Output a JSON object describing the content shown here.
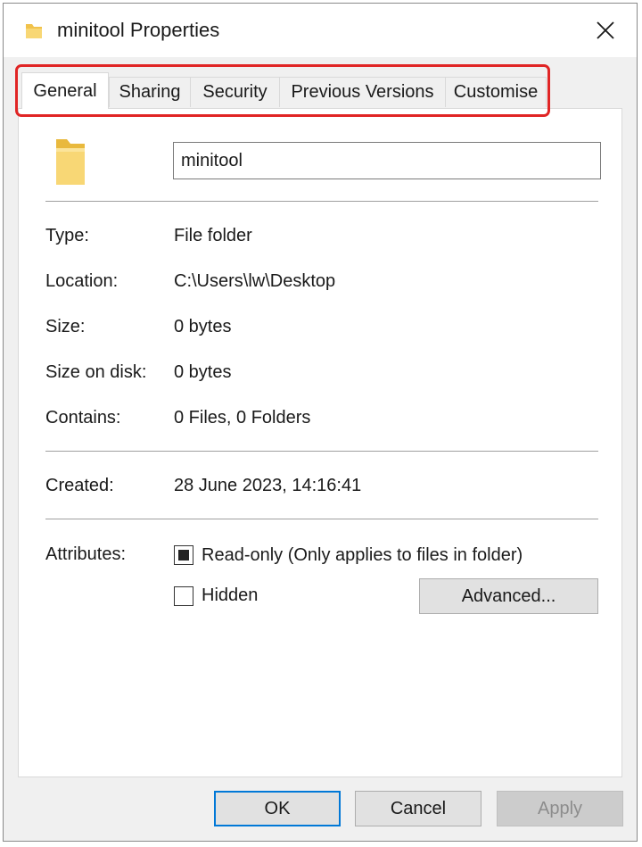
{
  "window": {
    "title": "minitool Properties"
  },
  "tabs": [
    {
      "label": "General",
      "active": true
    },
    {
      "label": "Sharing",
      "active": false
    },
    {
      "label": "Security",
      "active": false
    },
    {
      "label": "Previous Versions",
      "active": false
    },
    {
      "label": "Customise",
      "active": false
    }
  ],
  "general": {
    "name_value": "minitool",
    "type": {
      "label": "Type:",
      "value": "File folder"
    },
    "location": {
      "label": "Location:",
      "value": "C:\\Users\\lw\\Desktop"
    },
    "size": {
      "label": "Size:",
      "value": "0 bytes"
    },
    "size_on_disk": {
      "label": "Size on disk:",
      "value": "0 bytes"
    },
    "contains": {
      "label": "Contains:",
      "value": "0 Files, 0 Folders"
    },
    "created": {
      "label": "Created:",
      "value": "28 June 2023, 14:16:41"
    },
    "attributes": {
      "label": "Attributes:",
      "readonly": {
        "label": "Read-only (Only applies to files in folder)",
        "state": "indeterminate"
      },
      "hidden": {
        "label": "Hidden",
        "state": "unchecked"
      },
      "advanced_label": "Advanced..."
    }
  },
  "footer": {
    "ok_label": "OK",
    "cancel_label": "Cancel",
    "apply_label": "Apply"
  },
  "colors": {
    "highlight": "#e02525",
    "default_button_border": "#0078d7",
    "folder": "#f8d775"
  },
  "icons": {
    "title": "folder-icon",
    "close": "close-icon",
    "large": "folder-icon"
  }
}
